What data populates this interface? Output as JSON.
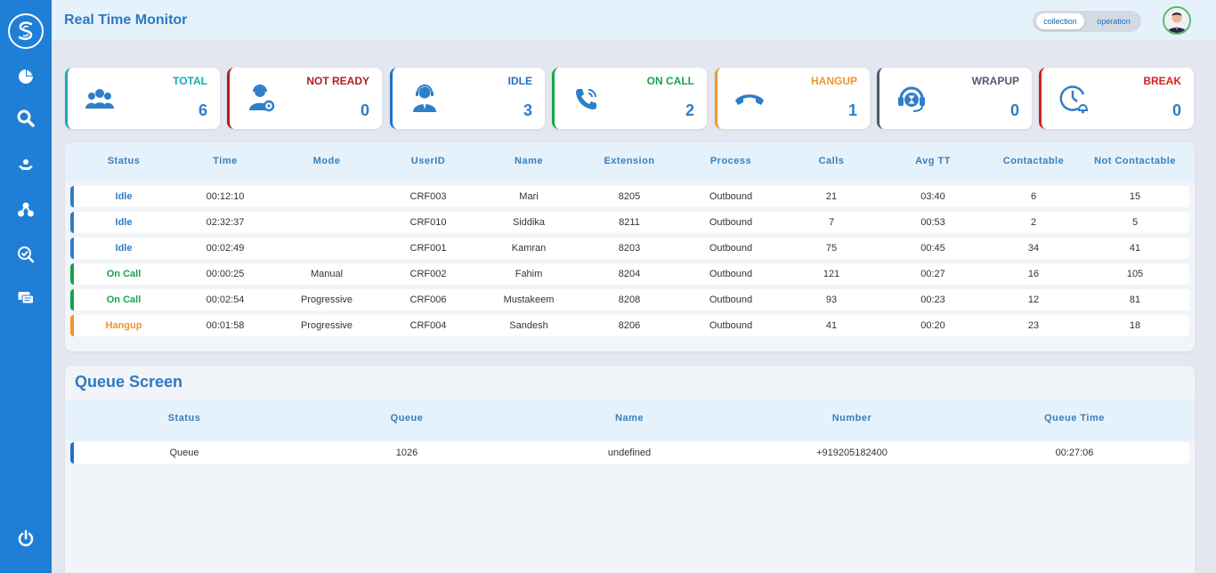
{
  "header": {
    "title": "Real Time Monitor",
    "toggle": [
      "collection",
      "operation"
    ]
  },
  "stats": [
    {
      "label": "TOTAL",
      "value": "6",
      "color": "#18aab5",
      "icon": "users-icon"
    },
    {
      "label": "NOT READY",
      "value": "0",
      "color": "#b21c1c",
      "icon": "agent-settings-icon"
    },
    {
      "label": "IDLE",
      "value": "3",
      "color": "#1f72c9",
      "icon": "agent-icon"
    },
    {
      "label": "ON CALL",
      "value": "2",
      "color": "#15a745",
      "icon": "phone-ringing-icon"
    },
    {
      "label": "HANGUP",
      "value": "1",
      "color": "#f0952a",
      "icon": "hangup-icon"
    },
    {
      "label": "WRAPUP",
      "value": "0",
      "color": "#4e5b6a",
      "icon": "headset-hourglass-icon"
    },
    {
      "label": "BREAK",
      "value": "0",
      "color": "#d0231f",
      "icon": "clock-bell-icon"
    }
  ],
  "agents": {
    "columns": [
      "Status",
      "Time",
      "Mode",
      "UserID",
      "Name",
      "Extension",
      "Process",
      "Calls",
      "Avg TT",
      "Contactable",
      "Not Contactable"
    ],
    "rows": [
      {
        "status": "Idle",
        "time": "00:12:10",
        "mode": "",
        "userid": "CRF003",
        "name": "Mari",
        "ext": "8205",
        "process": "Outbound",
        "calls": "21",
        "avg": "03:40",
        "cont": "6",
        "notcont": "15"
      },
      {
        "status": "Idle",
        "time": "02:32:37",
        "mode": "",
        "userid": "CRF010",
        "name": "Siddika",
        "ext": "8211",
        "process": "Outbound",
        "calls": "7",
        "avg": "00:53",
        "cont": "2",
        "notcont": "5"
      },
      {
        "status": "Idle",
        "time": "00:02:49",
        "mode": "",
        "userid": "CRF001",
        "name": "Kamran",
        "ext": "8203",
        "process": "Outbound",
        "calls": "75",
        "avg": "00:45",
        "cont": "34",
        "notcont": "41"
      },
      {
        "status": "On Call",
        "time": "00:00:25",
        "mode": "Manual",
        "userid": "CRF002",
        "name": "Fahim",
        "ext": "8204",
        "process": "Outbound",
        "calls": "121",
        "avg": "00:27",
        "cont": "16",
        "notcont": "105"
      },
      {
        "status": "On Call",
        "time": "00:02:54",
        "mode": "Progressive",
        "userid": "CRF006",
        "name": "Mustakeem",
        "ext": "8208",
        "process": "Outbound",
        "calls": "93",
        "avg": "00:23",
        "cont": "12",
        "notcont": "81"
      },
      {
        "status": "Hangup",
        "time": "00:01:58",
        "mode": "Progressive",
        "userid": "CRF004",
        "name": "Sandesh",
        "ext": "8206",
        "process": "Outbound",
        "calls": "41",
        "avg": "00:20",
        "cont": "23",
        "notcont": "18"
      }
    ]
  },
  "queue": {
    "title": "Queue Screen",
    "columns": [
      "Status",
      "Queue",
      "Name",
      "Number",
      "Queue Time"
    ],
    "rows": [
      {
        "status": "Queue",
        "queue": "1026",
        "name": "undefined",
        "number": "+919205182400",
        "time": "00:27:06"
      }
    ]
  },
  "colors": {
    "sidebar": "#1f7fd6",
    "idle": "#2e7ec8",
    "on_call": "#16a34a",
    "hangup": "#f0952a",
    "queue": "#1f72c9"
  }
}
